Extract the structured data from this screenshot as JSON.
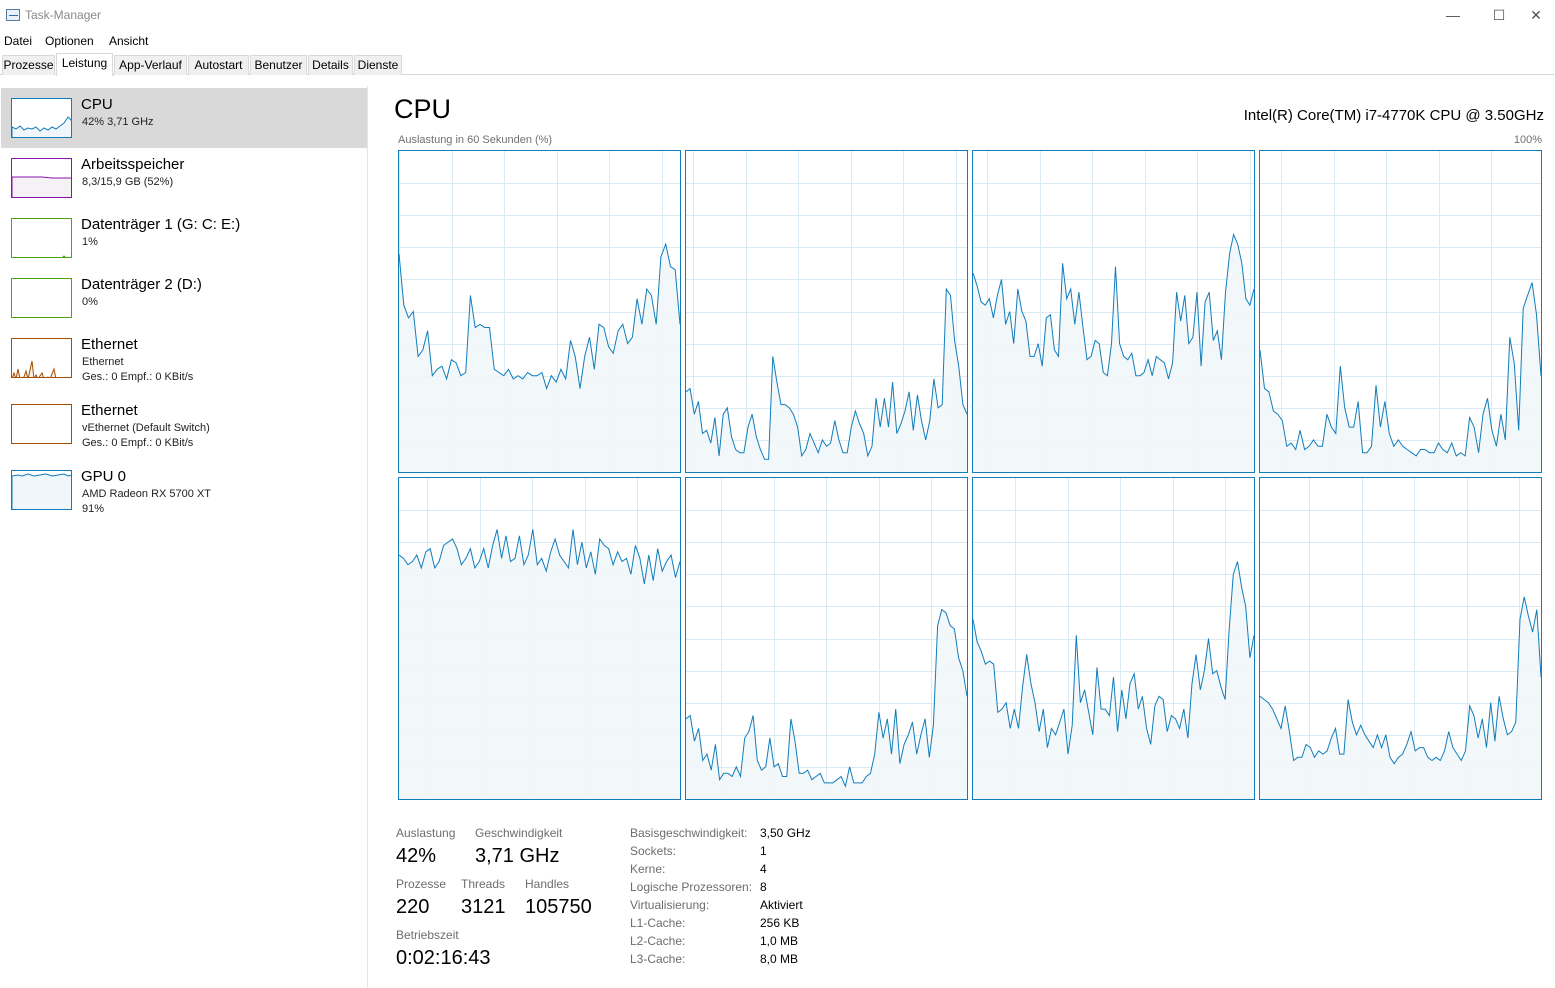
{
  "window": {
    "title": "Task-Manager",
    "minimize": "—",
    "maximize": "☐",
    "close": "✕"
  },
  "menu": [
    "Datei",
    "Optionen",
    "Ansicht"
  ],
  "tabs": [
    "Prozesse",
    "Leistung",
    "App-Verlauf",
    "Autostart",
    "Benutzer",
    "Details",
    "Dienste"
  ],
  "active_tab": "Leistung",
  "sidebar": {
    "items": [
      {
        "name": "CPU",
        "line1": "42%  3,71 GHz",
        "line2": "",
        "color": "#117dbb",
        "selected": true
      },
      {
        "name": "Arbeitsspeicher",
        "line1": "8,3/15,9 GB (52%)",
        "line2": "",
        "color": "#8b12ae"
      },
      {
        "name": "Datenträger 1 (G: C: E:)",
        "line1": "1%",
        "line2": "",
        "color": "#4da60c"
      },
      {
        "name": "Datenträger 2 (D:)",
        "line1": "0%",
        "line2": "",
        "color": "#4da60c"
      },
      {
        "name": "Ethernet",
        "line1": "Ethernet",
        "line2": "Ges.: 0 Empf.: 0 KBit/s",
        "color": "#a74f01"
      },
      {
        "name": "Ethernet",
        "line1": "vEthernet (Default Switch)",
        "line2": "Ges.: 0 Empf.: 0 KBit/s",
        "color": "#a74f01"
      },
      {
        "name": "GPU 0",
        "line1": "AMD Radeon RX 5700 XT",
        "line2": "91%",
        "color": "#117dbb"
      }
    ]
  },
  "main": {
    "heading": "CPU",
    "cpu_model": "Intel(R) Core(TM) i7-4770K CPU @ 3.50GHz",
    "graph_label": "Auslastung in 60 Sekunden (%)",
    "graph_max": "100%",
    "accent_color": "#117dbb",
    "fill_color": "#f1f6fa",
    "grid_color": "#d9eaf4"
  },
  "chart_data": {
    "type": "line",
    "title": "",
    "xlabel": "",
    "ylabel": "",
    "ylim": [
      0,
      100
    ],
    "x_points": 60,
    "grid": true,
    "series": [
      {
        "values": [
          68,
          52,
          48,
          50,
          36,
          38,
          44,
          30,
          32,
          33,
          29,
          35,
          34,
          30,
          31,
          55,
          45,
          46,
          45,
          45,
          32,
          31,
          30,
          32,
          29,
          30,
          29,
          31,
          30,
          30,
          31,
          26,
          30,
          28,
          32,
          29,
          41,
          36,
          26,
          36,
          42,
          32,
          46,
          45,
          39,
          37,
          44,
          46,
          40,
          42,
          54,
          46,
          57,
          55,
          46,
          67,
          71,
          64,
          63,
          46
        ]
      },
      {
        "values": [
          25,
          26,
          18,
          22,
          12,
          13,
          9,
          17,
          5,
          18,
          20,
          11,
          7,
          6,
          6,
          14,
          18,
          11,
          7,
          4,
          4,
          36,
          28,
          21,
          21,
          20,
          18,
          14,
          5,
          7,
          12,
          9,
          6,
          10,
          8,
          9,
          16,
          10,
          6,
          6,
          14,
          19,
          15,
          12,
          5,
          8,
          23,
          14,
          23,
          14,
          28,
          12,
          15,
          19,
          25,
          13,
          24,
          16,
          10,
          16,
          29,
          20,
          21,
          57,
          55,
          41,
          33,
          21,
          18
        ]
      },
      {
        "values": [
          62,
          58,
          53,
          52,
          54,
          48,
          55,
          60,
          46,
          50,
          40,
          57,
          50,
          47,
          36,
          36,
          40,
          33,
          48,
          49,
          38,
          36,
          65,
          54,
          57,
          46,
          56,
          45,
          35,
          36,
          41,
          40,
          31,
          30,
          40,
          64,
          40,
          36,
          35,
          37,
          30,
          30,
          31,
          35,
          30,
          36,
          35,
          34,
          29,
          34,
          56,
          47,
          55,
          40,
          42,
          56,
          33,
          53,
          56,
          41,
          44,
          35,
          56,
          68,
          74,
          71,
          65,
          54,
          52,
          57
        ]
      },
      {
        "values": [
          38,
          26,
          25,
          19,
          18,
          16,
          8,
          9,
          7,
          13,
          7,
          8,
          10,
          8,
          8,
          18,
          14,
          12,
          33,
          20,
          14,
          14,
          22,
          6,
          6,
          8,
          27,
          14,
          22,
          12,
          8,
          10,
          8,
          7,
          6,
          5,
          7,
          7,
          6,
          6,
          9,
          7,
          6,
          9,
          5,
          6,
          5,
          17,
          14,
          6,
          18,
          23,
          13,
          8,
          18,
          10,
          42,
          34,
          13,
          51,
          55,
          59,
          49,
          30
        ]
      },
      {
        "values": [
          76,
          75,
          73,
          74,
          76,
          72,
          77,
          78,
          72,
          74,
          79,
          80,
          81,
          78,
          73,
          75,
          78,
          72,
          74,
          78,
          72,
          79,
          84,
          75,
          82,
          74,
          75,
          82,
          73,
          76,
          84,
          73,
          75,
          71,
          77,
          81,
          76,
          74,
          72,
          84,
          73,
          80,
          72,
          77,
          70,
          81,
          79,
          78,
          73,
          77,
          74,
          75,
          70,
          79,
          75,
          67,
          76,
          68,
          78,
          71,
          74,
          76,
          69,
          74
        ]
      },
      {
        "values": [
          25,
          26,
          18,
          22,
          12,
          14,
          9,
          17,
          6,
          8,
          8,
          7,
          10,
          7,
          19,
          21,
          26,
          12,
          9,
          10,
          19,
          10,
          11,
          7,
          7,
          25,
          18,
          8,
          8,
          9,
          6,
          7,
          8,
          5,
          5,
          5,
          6,
          7,
          4,
          10,
          5,
          5,
          5,
          7,
          8,
          14,
          27,
          19,
          25,
          14,
          28,
          11,
          17,
          20,
          24,
          14,
          20,
          25,
          13,
          23,
          54,
          59,
          58,
          54,
          53,
          44,
          40,
          32
        ]
      },
      {
        "values": [
          56,
          49,
          46,
          42,
          43,
          42,
          27,
          28,
          30,
          22,
          28,
          22,
          35,
          45,
          36,
          30,
          21,
          28,
          16,
          22,
          20,
          24,
          28,
          14,
          23,
          51,
          30,
          34,
          27,
          20,
          41,
          28,
          28,
          26,
          38,
          21,
          34,
          25,
          36,
          39,
          28,
          32,
          22,
          17,
          29,
          32,
          31,
          21,
          26,
          25,
          22,
          28,
          19,
          36,
          45,
          34,
          40,
          50,
          39,
          40,
          35,
          31,
          53,
          70,
          74,
          66,
          60,
          44,
          51
        ]
      },
      {
        "values": [
          32,
          31,
          30,
          28,
          25,
          22,
          29,
          21,
          12,
          13,
          13,
          17,
          16,
          13,
          15,
          14,
          15,
          19,
          22,
          14,
          14,
          31,
          24,
          20,
          23,
          20,
          18,
          16,
          20,
          16,
          20,
          13,
          11,
          13,
          14,
          17,
          21,
          15,
          16,
          16,
          13,
          12,
          13,
          12,
          15,
          21,
          16,
          14,
          12,
          15,
          29,
          26,
          19,
          25,
          16,
          30,
          18,
          32,
          25,
          20,
          21,
          24,
          56,
          63,
          57,
          52,
          59,
          38
        ]
      }
    ]
  },
  "stats": {
    "utilization": {
      "label": "Auslastung",
      "value": "42%"
    },
    "speed": {
      "label": "Geschwindigkeit",
      "value": "3,71 GHz"
    },
    "processes": {
      "label": "Prozesse",
      "value": "220"
    },
    "threads": {
      "label": "Threads",
      "value": "3121"
    },
    "handles": {
      "label": "Handles",
      "value": "105750"
    },
    "uptime": {
      "label": "Betriebszeit",
      "value": "0:02:16:43"
    },
    "details": [
      {
        "key": "Basisgeschwindigkeit:",
        "value": "3,50 GHz"
      },
      {
        "key": "Sockets:",
        "value": "1"
      },
      {
        "key": "Kerne:",
        "value": "4"
      },
      {
        "key": "Logische Prozessoren:",
        "value": "8"
      },
      {
        "key": "Virtualisierung:",
        "value": "Aktiviert"
      },
      {
        "key": "L1-Cache:",
        "value": "256 KB"
      },
      {
        "key": "L2-Cache:",
        "value": "1,0 MB"
      },
      {
        "key": "L3-Cache:",
        "value": "8,0 MB"
      }
    ]
  }
}
